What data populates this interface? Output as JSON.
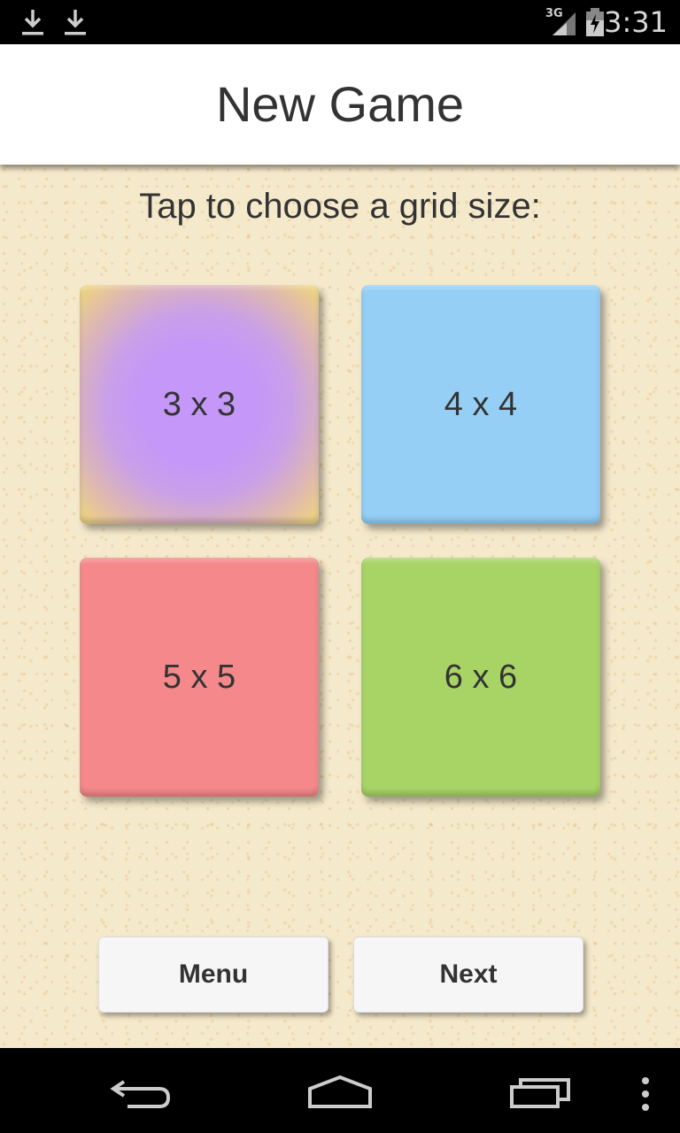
{
  "status_bar": {
    "time": "3:31",
    "network": "3G",
    "icons": [
      "download-icon",
      "download-icon",
      "signal-icon",
      "battery-icon"
    ]
  },
  "header": {
    "title": "New Game"
  },
  "main": {
    "prompt": "Tap to choose a grid size:",
    "tiles": [
      {
        "label": "3 x 3",
        "color": "#c597f8",
        "border_color": "#f1d87a",
        "selected": true
      },
      {
        "label": "4 x 4",
        "color": "#95cff5",
        "selected": false
      },
      {
        "label": "5 x 5",
        "color": "#f5888a",
        "selected": false
      },
      {
        "label": "6 x 6",
        "color": "#a8d466",
        "selected": false
      }
    ]
  },
  "buttons": {
    "menu_label": "Menu",
    "next_label": "Next"
  },
  "nav_bar": {
    "icons": [
      "back-icon",
      "home-icon",
      "recents-icon",
      "overflow-menu-icon"
    ]
  }
}
